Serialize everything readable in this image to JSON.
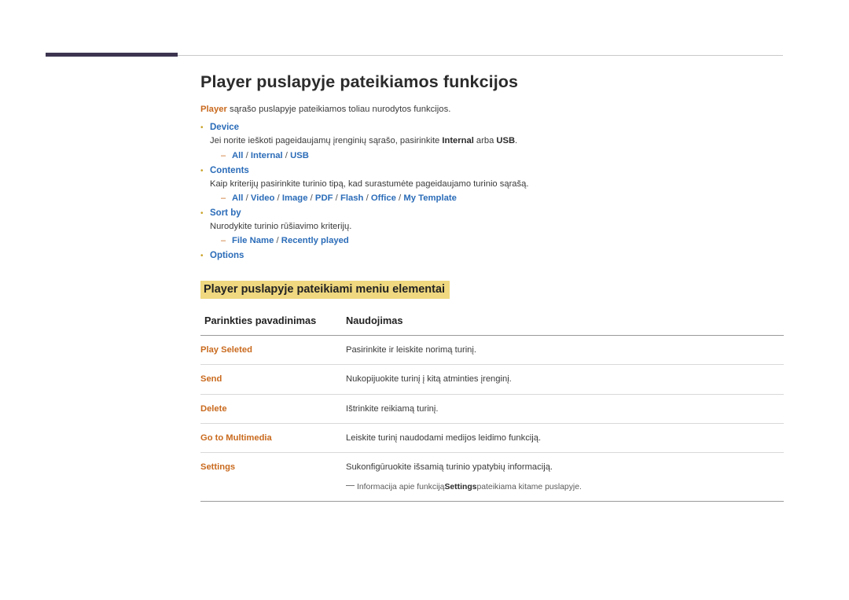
{
  "page": {
    "title": "Player puslapyje pateikiamos funkcijos",
    "intro": {
      "keyword": "Player",
      "rest": " sąrašo puslapyje pateikiamos toliau nurodytos funkcijos."
    },
    "bullets": [
      {
        "label": "Device",
        "desc_before": "Jei norite ieškoti pageidaujamų įrenginių sąrašo, pasirinkite ",
        "desc_kw1": "Internal",
        "desc_mid": " arba ",
        "desc_kw2": "USB",
        "desc_after": ".",
        "options": "All / Internal / USB"
      },
      {
        "label": "Contents",
        "desc_before": "Kaip kriterijų pasirinkite turinio tipą, kad surastumėte pageidaujamo turinio sąrašą.",
        "desc_kw1": "",
        "desc_mid": "",
        "desc_kw2": "",
        "desc_after": "",
        "options": "All / Video / Image / PDF / Flash / Office / My Template"
      },
      {
        "label": "Sort by",
        "desc_before": "Nurodykite turinio rūšiavimo kriterijų.",
        "desc_kw1": "",
        "desc_mid": "",
        "desc_kw2": "",
        "desc_after": "",
        "options": "File Name / Recently played"
      },
      {
        "label": "Options",
        "desc_before": "",
        "desc_kw1": "",
        "desc_mid": "",
        "desc_kw2": "",
        "desc_after": "",
        "options": ""
      }
    ],
    "section_heading": "Player puslapyje pateikiami meniu elementai",
    "table": {
      "headers": [
        "Parinkties pavadinimas",
        "Naudojimas"
      ],
      "rows": [
        {
          "term": "Play Seleted",
          "desc": "Pasirinkite ir leiskite norimą turinį."
        },
        {
          "term": "Send",
          "desc": "Nukopijuokite turinį į kitą atminties įrenginį."
        },
        {
          "term": "Delete",
          "desc": "Ištrinkite reikiamą turinį."
        },
        {
          "term": "Go to Multimedia",
          "desc": "Leiskite turinį naudodami medijos leidimo funkciją."
        },
        {
          "term": "Settings",
          "desc": "Sukonfigūruokite išsamią turinio ypatybių informaciją."
        }
      ],
      "note": {
        "before": "Informacija apie funkciją ",
        "keyword": "Settings",
        "after": " pateikiama kitame puslapyje."
      }
    }
  }
}
